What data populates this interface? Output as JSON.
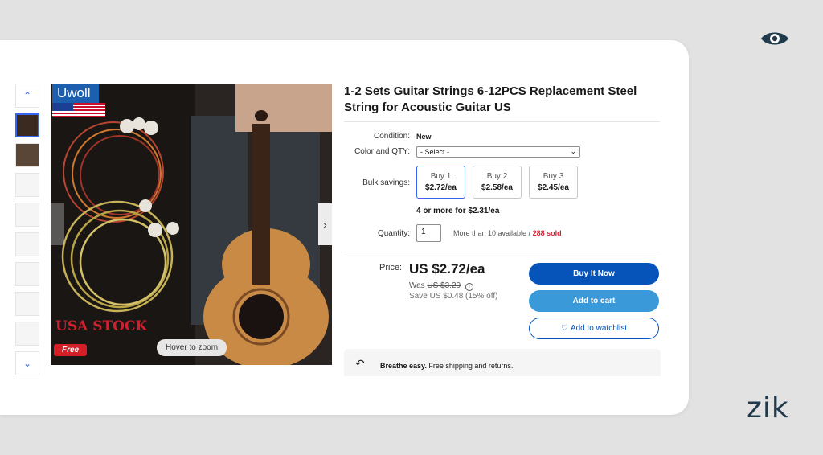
{
  "overlay": {
    "eye_icon": "eye-icon",
    "brand": "zik"
  },
  "gallery": {
    "hover_zoom": "Hover to zoom",
    "image_text": {
      "brand": "Uwoll",
      "stock": "USA STOCK",
      "free": "Free"
    }
  },
  "product": {
    "title": "1-2 Sets Guitar Strings 6-12PCS Replacement Steel String for Acoustic Guitar US"
  },
  "condition": {
    "label": "Condition:",
    "value": "New"
  },
  "variant": {
    "label": "Color and QTY:",
    "selected": "- Select -"
  },
  "bulk": {
    "label": "Bulk savings:",
    "options": [
      {
        "name": "Buy 1",
        "price": "$2.72/ea"
      },
      {
        "name": "Buy 2",
        "price": "$2.58/ea"
      },
      {
        "name": "Buy 3",
        "price": "$2.45/ea"
      }
    ],
    "more": "4 or more for $2.31/ea"
  },
  "quantity": {
    "label": "Quantity:",
    "value": "1",
    "available": "More than 10 available",
    "separator": " / ",
    "sold": "288 sold"
  },
  "pricing": {
    "label": "Price:",
    "price": "US $2.72/ea",
    "was_label": "Was",
    "was_price": "US $3.20",
    "save": "Save US $0.48 (15% off)"
  },
  "actions": {
    "buy_now": "Buy It Now",
    "add_to_cart": "Add to cart",
    "watchlist": "Add to watchlist"
  },
  "shipping": {
    "bold": "Breathe easy.",
    "text": " Free shipping and returns."
  },
  "colors": {
    "primary": "#0654ba",
    "cart": "#3a9ad9",
    "sold": "#dd1e31",
    "selected_border": "#3665f3"
  }
}
